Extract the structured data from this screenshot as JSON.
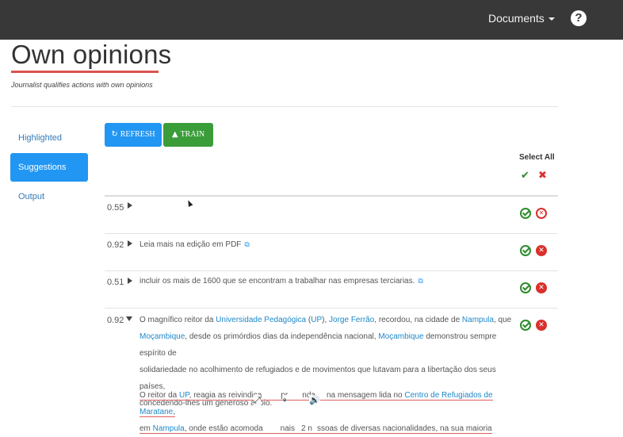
{
  "topbar": {
    "documents_label": "Documents",
    "help_label": "?"
  },
  "header": {
    "title": "Own opinions",
    "subtitle": "Journalist qualifies actions with own opinions"
  },
  "sidebar": {
    "items": [
      {
        "label": "Highlighted",
        "active": false
      },
      {
        "label": "Suggestions",
        "active": true
      },
      {
        "label": "Output",
        "active": false
      }
    ]
  },
  "toolbar": {
    "refresh_label": "REFRESH",
    "train_label": "TRAIN",
    "select_all_label": "Select All"
  },
  "rows": [
    {
      "score": "0.55",
      "text": ""
    },
    {
      "score": "0.92",
      "text": "Leia mais na edição em PDF"
    },
    {
      "score": "0.51",
      "text": "incluir os mais de 1600 que se encontram a trabalhar nas empresas terciarias."
    },
    {
      "score": "0.92",
      "p1": {
        "a": "O magnífico reitor da ",
        "link1": "Universidade Pedagógica",
        "b": " (",
        "link2": "UP",
        "c": "), ",
        "link3": "Jorge Ferrão",
        "d": ", recordou, na cidade de ",
        "link4": "Nampula",
        "e": ", que",
        "link5": "Moçambique",
        "f": ", desde os primórdios dias da independência nacional, ",
        "link6": "Moçambique",
        "g": " demonstrou sempre espírito de",
        "line3": "solidariedade no acolhimento de refugiados e de movimentos que lutavam para a libertação dos seus países,",
        "line4": "concedendo-lhes um generoso apoio."
      },
      "p2": {
        "a": "O reitor da ",
        "link1": "UP",
        "b": ", reagia as reivindica",
        "b2": "pr",
        "b3": "nda",
        "b4": "na mensagem lida no ",
        "link2": "Centro de Refugiados de Maratane",
        "c": ",",
        "d": "em ",
        "link3": "Nampula",
        "e": ", onde estão acomoda",
        "e2": "nais",
        "e3": "2 n",
        "e4": "ssoas de diversas nacionalidades, na sua maioria"
      }
    }
  ]
}
